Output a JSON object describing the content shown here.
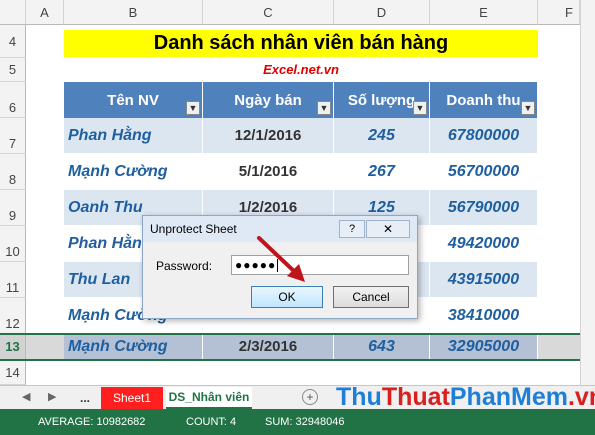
{
  "columns": [
    "A",
    "B",
    "C",
    "D",
    "E",
    "F"
  ],
  "rows": [
    "4",
    "5",
    "6",
    "7",
    "8",
    "9",
    "10",
    "11",
    "12",
    "13",
    "14"
  ],
  "sheet": {
    "title": "Danh sách nhân viên bán hàng",
    "subtitle": "Excel.net.vn",
    "headers": [
      "Tên NV",
      "Ngày bán",
      "Số lượng",
      "Doanh thu"
    ],
    "data": [
      {
        "name": "Phan Hằng",
        "date": "12/1/2016",
        "qty": "245",
        "revenue": "67800000"
      },
      {
        "name": "Mạnh Cường",
        "date": "5/1/2016",
        "qty": "267",
        "revenue": "56700000"
      },
      {
        "name": "Oanh Thu",
        "date": "1/2/2016",
        "qty": "125",
        "revenue": "56790000"
      },
      {
        "name": "Phan Hằng",
        "date": "",
        "qty": "",
        "revenue": "49420000"
      },
      {
        "name": "Thu Lan",
        "date": "",
        "qty": "",
        "revenue": "43915000"
      },
      {
        "name": "Mạnh Cường",
        "date": "",
        "qty": "",
        "revenue": "38410000"
      },
      {
        "name": "Mạnh Cường",
        "date": "2/3/2016",
        "qty": "643",
        "revenue": "32905000"
      }
    ]
  },
  "dialog": {
    "title": "Unprotect Sheet",
    "help": "?",
    "close": "✕",
    "password_label": "Password:",
    "password_value": "●●●●●",
    "ok_label": "OK",
    "cancel_label": "Cancel"
  },
  "tabs": {
    "prev": "◀",
    "next": "▶",
    "dots": "...",
    "sheet1": "Sheet1",
    "active": "DS_Nhân viên",
    "add": "+"
  },
  "status": {
    "average": "AVERAGE: 10982682",
    "count": "COUNT: 4",
    "sum": "SUM: 32948046"
  },
  "watermark": {
    "part1": "Thu",
    "part2": "Thuat",
    "part3": "PhanMem",
    "part4": ".vn"
  },
  "colors": {
    "excel_green": "#217346",
    "header_blue": "#4f81bd",
    "row_band": "#dce6f1",
    "title_yellow": "#ffff00",
    "sheet1_red": "#ff1f1f"
  }
}
